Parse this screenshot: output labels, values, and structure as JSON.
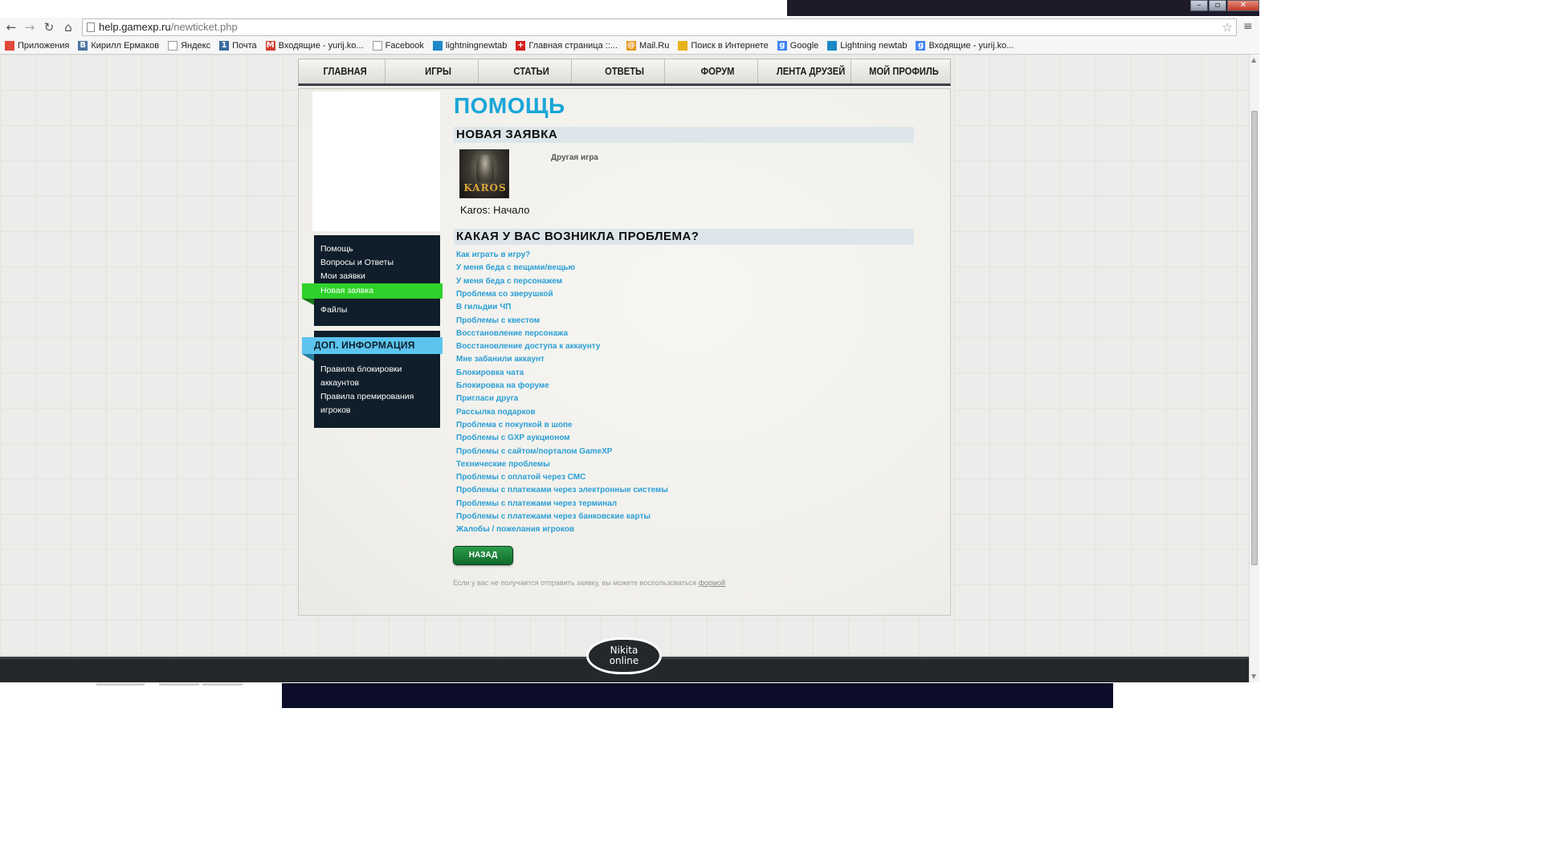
{
  "browser": {
    "url_domain": "help.gamexp.ru",
    "url_path": "/newticket.php",
    "window_buttons": {
      "minimize": "–",
      "maximize": "▫",
      "close": "✕"
    },
    "bookmarks": [
      {
        "label": "Приложения",
        "icon": "apps-grid-icon",
        "color": "#e04a3a"
      },
      {
        "label": "Кирилл Ермаков",
        "icon": "vk-icon",
        "color": "#4c75a3",
        "glyph": "В"
      },
      {
        "label": "Яндекс",
        "icon": "page-icon",
        "color": "#ffffff"
      },
      {
        "label": "Почта",
        "icon": "mail-1-icon",
        "color": "#3b6aa0",
        "glyph": "1"
      },
      {
        "label": "Входящие - yurij.ko...",
        "icon": "gmail-icon",
        "color": "#d23f31",
        "glyph": "M"
      },
      {
        "label": "Facebook",
        "icon": "page-icon",
        "color": "#ffffff"
      },
      {
        "label": "lightningnewtab",
        "icon": "lightning-icon",
        "color": "#1e88c8"
      },
      {
        "label": "Главная страница ::...",
        "icon": "red-cross-icon",
        "color": "#d32020",
        "glyph": "+"
      },
      {
        "label": "Mail.Ru",
        "icon": "mailru-icon",
        "color": "#e8961e",
        "glyph": "@"
      },
      {
        "label": "Поиск в Интернете",
        "icon": "search-icon",
        "color": "#e8b21e"
      },
      {
        "label": "Google",
        "icon": "google-icon",
        "color": "#4285f4",
        "glyph": "g"
      },
      {
        "label": "Lightning newtab",
        "icon": "lightning-icon",
        "color": "#1e88c8"
      },
      {
        "label": "Входящие - yurij.ko...",
        "icon": "google-icon",
        "color": "#4285f4",
        "glyph": "g"
      }
    ]
  },
  "nav": {
    "items": [
      "ГЛАВНАЯ",
      "ИГРЫ",
      "СТАТЬИ",
      "ОТВЕТЫ",
      "ФОРУМ",
      "ЛЕНТА ДРУЗЕЙ",
      "МОЙ ПРОФИЛЬ"
    ]
  },
  "sidebar": {
    "menu": [
      "Помощь",
      "Вопросы и Ответы",
      "Мои заявки",
      "Новая заявка",
      "Файлы"
    ],
    "active_index": 3,
    "info_title": "ДОП. ИНФОРМАЦИЯ",
    "info_items": [
      "Правила блокировки аккаунтов",
      "Правила премирования игроков"
    ]
  },
  "main": {
    "title": "ПОМОЩЬ",
    "new_ticket_header": "НОВАЯ ЗАЯВКА",
    "game": {
      "name": "Karos: Начало",
      "logo_text": "KAROS"
    },
    "other_game": "Другая игра",
    "problem_header": "КАКАЯ У ВАС ВОЗНИКЛА ПРОБЛЕМА?",
    "problems": [
      "Как играть в игру?",
      "У меня беда с вещами/вещью",
      "У меня беда с персонажем",
      "Проблема со зверушкой",
      "В гильдии ЧП",
      "Проблемы с квестом",
      "Восстановление персонажа",
      "Восстановление доступа к аккаунту",
      "Мне забанили аккаунт",
      "Блокировка чата",
      "Блокировка на форуме",
      "Пригласи друга",
      "Рассылка подарков",
      "Проблема с покупкой в шопе",
      "Проблемы с GXP аукционом",
      "Проблемы с сайтом/порталом GameXP",
      "Технические проблемы",
      "Проблемы с оплатой через СМС",
      "Проблемы с платежами через электронные системы",
      "Проблемы с платежами через терминал",
      "Проблемы с платежами через банковские карты",
      "Жалобы / пожелания игроков"
    ],
    "back_button": "НАЗАД",
    "footnote": "Если у вас не получается отправить заявку, вы можете воспользоваться",
    "footnote_link": "формой"
  },
  "footer": {
    "logo_line1": "Nikita",
    "logo_line2": "online"
  },
  "colors": {
    "title_blue": "#19a6d8",
    "link_blue": "#2b9fd6",
    "active_green": "#2ed22a",
    "sidebar_dark": "#0f1e2a",
    "info_blue": "#5bc4ef",
    "button_green": "#1a7f38"
  }
}
